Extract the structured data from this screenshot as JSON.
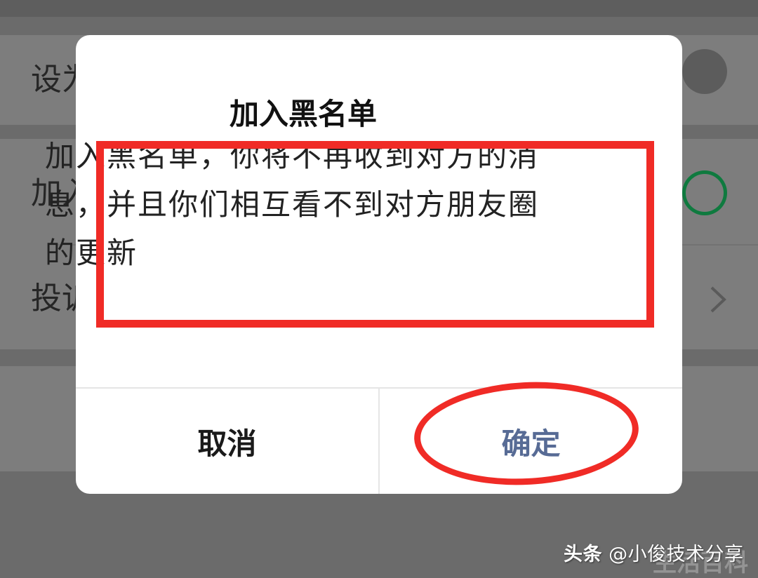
{
  "background": {
    "rows": [
      {
        "label": "设为",
        "toggle": "off"
      },
      {
        "label": "加入",
        "toggle": "on"
      },
      {
        "label": "投诉",
        "control": "chevron-right-icon"
      }
    ]
  },
  "dialog": {
    "title": "加入黑名单",
    "message": "加入黑名单，你将不再收到对方的消息，并且你们相互看不到对方朋友圈的更新",
    "cancel_label": "取消",
    "confirm_label": "确定"
  },
  "watermark": {
    "brand": "头条",
    "handle": "@小俊技术分享",
    "faint": "生活百科"
  },
  "colors": {
    "annotation": "#f02b26",
    "confirm_text": "#576b95",
    "toggle_on": "#0f7a3f"
  }
}
